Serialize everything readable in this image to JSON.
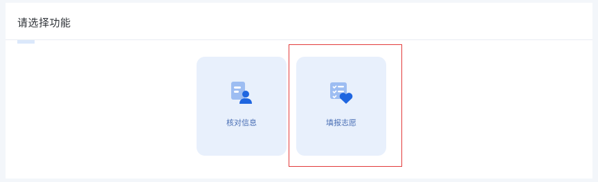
{
  "panel": {
    "title": "请选择功能"
  },
  "functions": [
    {
      "label": "核对信息",
      "icon": "document-user-icon"
    },
    {
      "label": "填报志愿",
      "icon": "checklist-heart-icon"
    }
  ],
  "colors": {
    "card_bg": "#e8f0fc",
    "icon_light": "#9dbdf2",
    "icon_dark": "#1f66e0",
    "label": "#4a6fb5",
    "highlight": "#e23a3a"
  }
}
